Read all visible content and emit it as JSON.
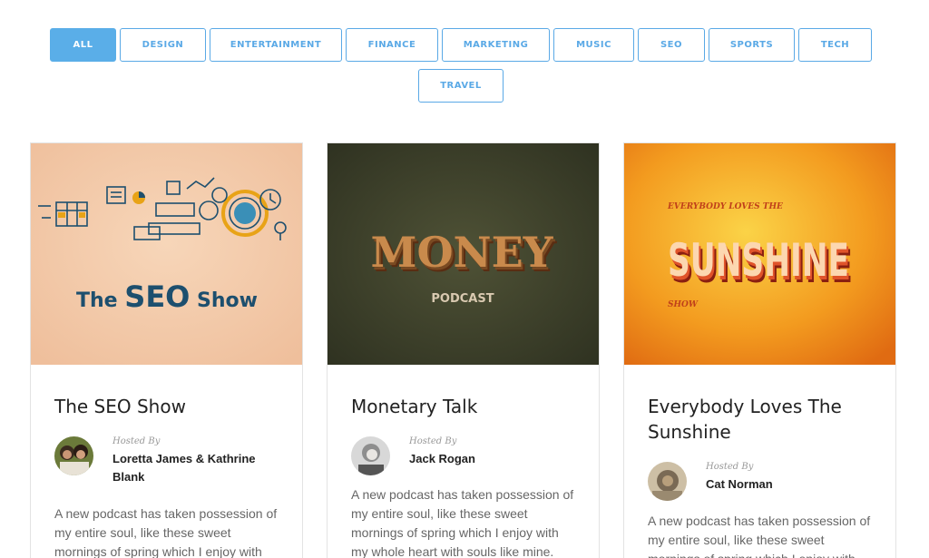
{
  "filters": [
    "ALL",
    "DESIGN",
    "ENTERTAINMENT",
    "FINANCE",
    "MARKETING",
    "MUSIC",
    "SEO",
    "SPORTS",
    "TECH",
    "TRAVEL"
  ],
  "active_filter": "ALL",
  "colors": {
    "accent": "#5aaee8",
    "text": "#222222",
    "muted": "#666666"
  },
  "cards": [
    {
      "title": "The SEO Show",
      "cover_text": "The SEO Show",
      "hosted_by_label": "Hosted By",
      "host": "Loretta James & Kathrine Blank",
      "description": "A new podcast has taken possession of my entire soul, like these sweet mornings of spring which I enjoy with"
    },
    {
      "title": "Monetary Talk",
      "cover_text": "MONEY",
      "cover_subtext": "PODCAST",
      "hosted_by_label": "Hosted By",
      "host": "Jack Rogan",
      "description": "A new podcast has taken possession of my entire soul, like these sweet mornings of spring which I enjoy with my whole heart with souls like mine."
    },
    {
      "title": "Everybody Loves The Sunshine",
      "cover_top": "EVERYBODY LOVES THE",
      "cover_text": "SUNSHINE",
      "cover_subtext": "SHOW",
      "hosted_by_label": "Hosted By",
      "host": "Cat Norman",
      "description": "A new podcast has taken possession of my entire soul, like these sweet mornings of spring which I enjoy with"
    }
  ]
}
